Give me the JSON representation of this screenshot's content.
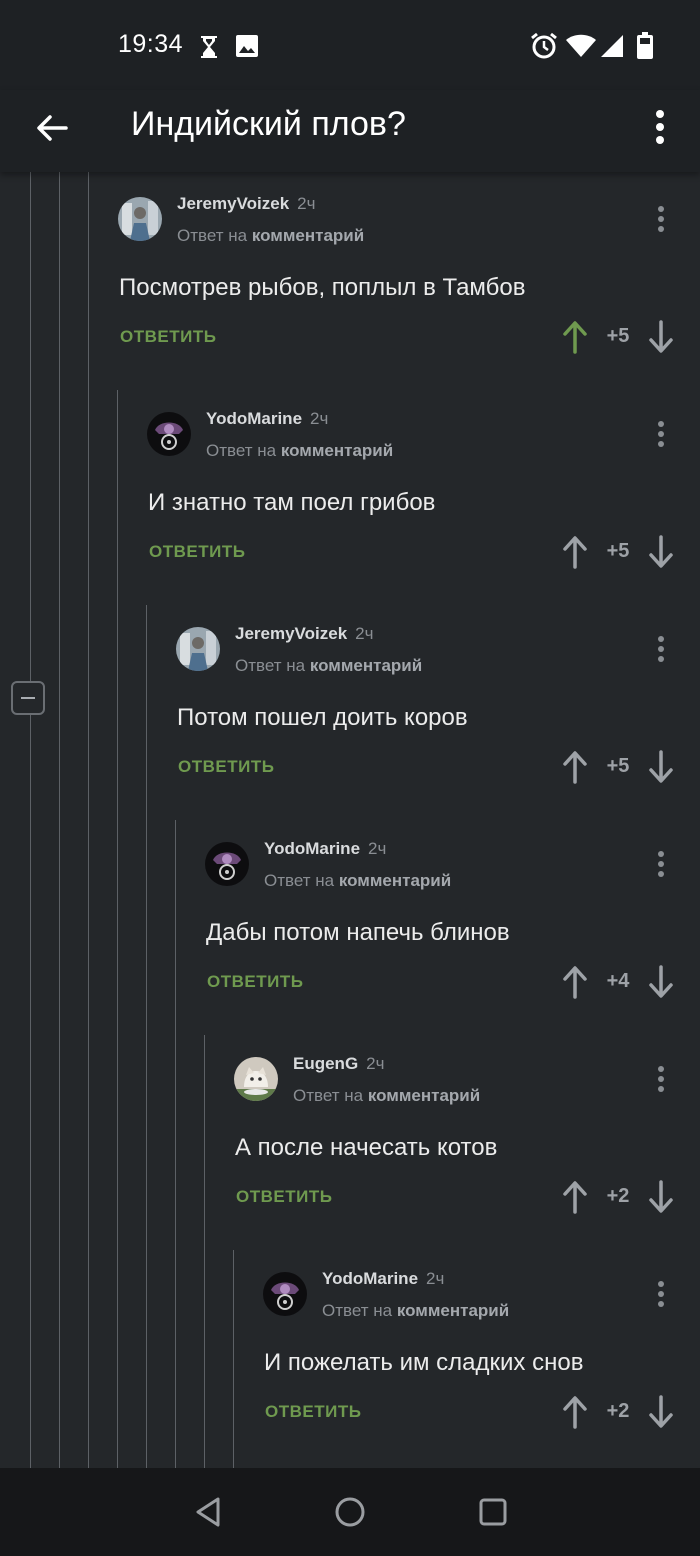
{
  "status_bar": {
    "time": "19:34"
  },
  "app_bar": {
    "title": "Индийский плов?"
  },
  "comments": [
    {
      "author": "JeremyVoizek",
      "time": "2ч",
      "reply_prefix": "Ответ на",
      "reply_target": "комментарий",
      "text": "Посмотрев рыбов, поплыл в Тамбов",
      "reply_label": "ОТВЕТИТЬ",
      "score": "+5",
      "upvoted": true
    },
    {
      "author": "YodoMarine",
      "time": "2ч",
      "reply_prefix": "Ответ на",
      "reply_target": "комментарий",
      "text": "И знатно там поел грибов",
      "reply_label": "ОТВЕТИТЬ",
      "score": "+5",
      "upvoted": false
    },
    {
      "author": "JeremyVoizek",
      "time": "2ч",
      "reply_prefix": "Ответ на",
      "reply_target": "комментарий",
      "text": "Потом пошел доить коров",
      "reply_label": "ОТВЕТИТЬ",
      "score": "+5",
      "upvoted": false
    },
    {
      "author": "YodoMarine",
      "time": "2ч",
      "reply_prefix": "Ответ на",
      "reply_target": "комментарий",
      "text": "Дабы потом напечь блинов",
      "reply_label": "ОТВЕТИТЬ",
      "score": "+4",
      "upvoted": false
    },
    {
      "author": "EugenG",
      "time": "2ч",
      "reply_prefix": "Ответ на",
      "reply_target": "комментарий",
      "text": "А после начесать котов",
      "reply_label": "ОТВЕТИТЬ",
      "score": "+2",
      "upvoted": false
    },
    {
      "author": "YodoMarine",
      "time": "2ч",
      "reply_prefix": "Ответ на",
      "reply_target": "комментарий",
      "text": "И пожелать им сладких снов",
      "reply_label": "ОТВЕТИТЬ",
      "score": "+2",
      "upvoted": false
    }
  ],
  "colors": {
    "background": "#24272a",
    "bar": "#1e2124",
    "reply_green": "#6f9a4f",
    "upvote_active": "#6f9a4f",
    "vote_inactive": "#9ea2a7"
  }
}
